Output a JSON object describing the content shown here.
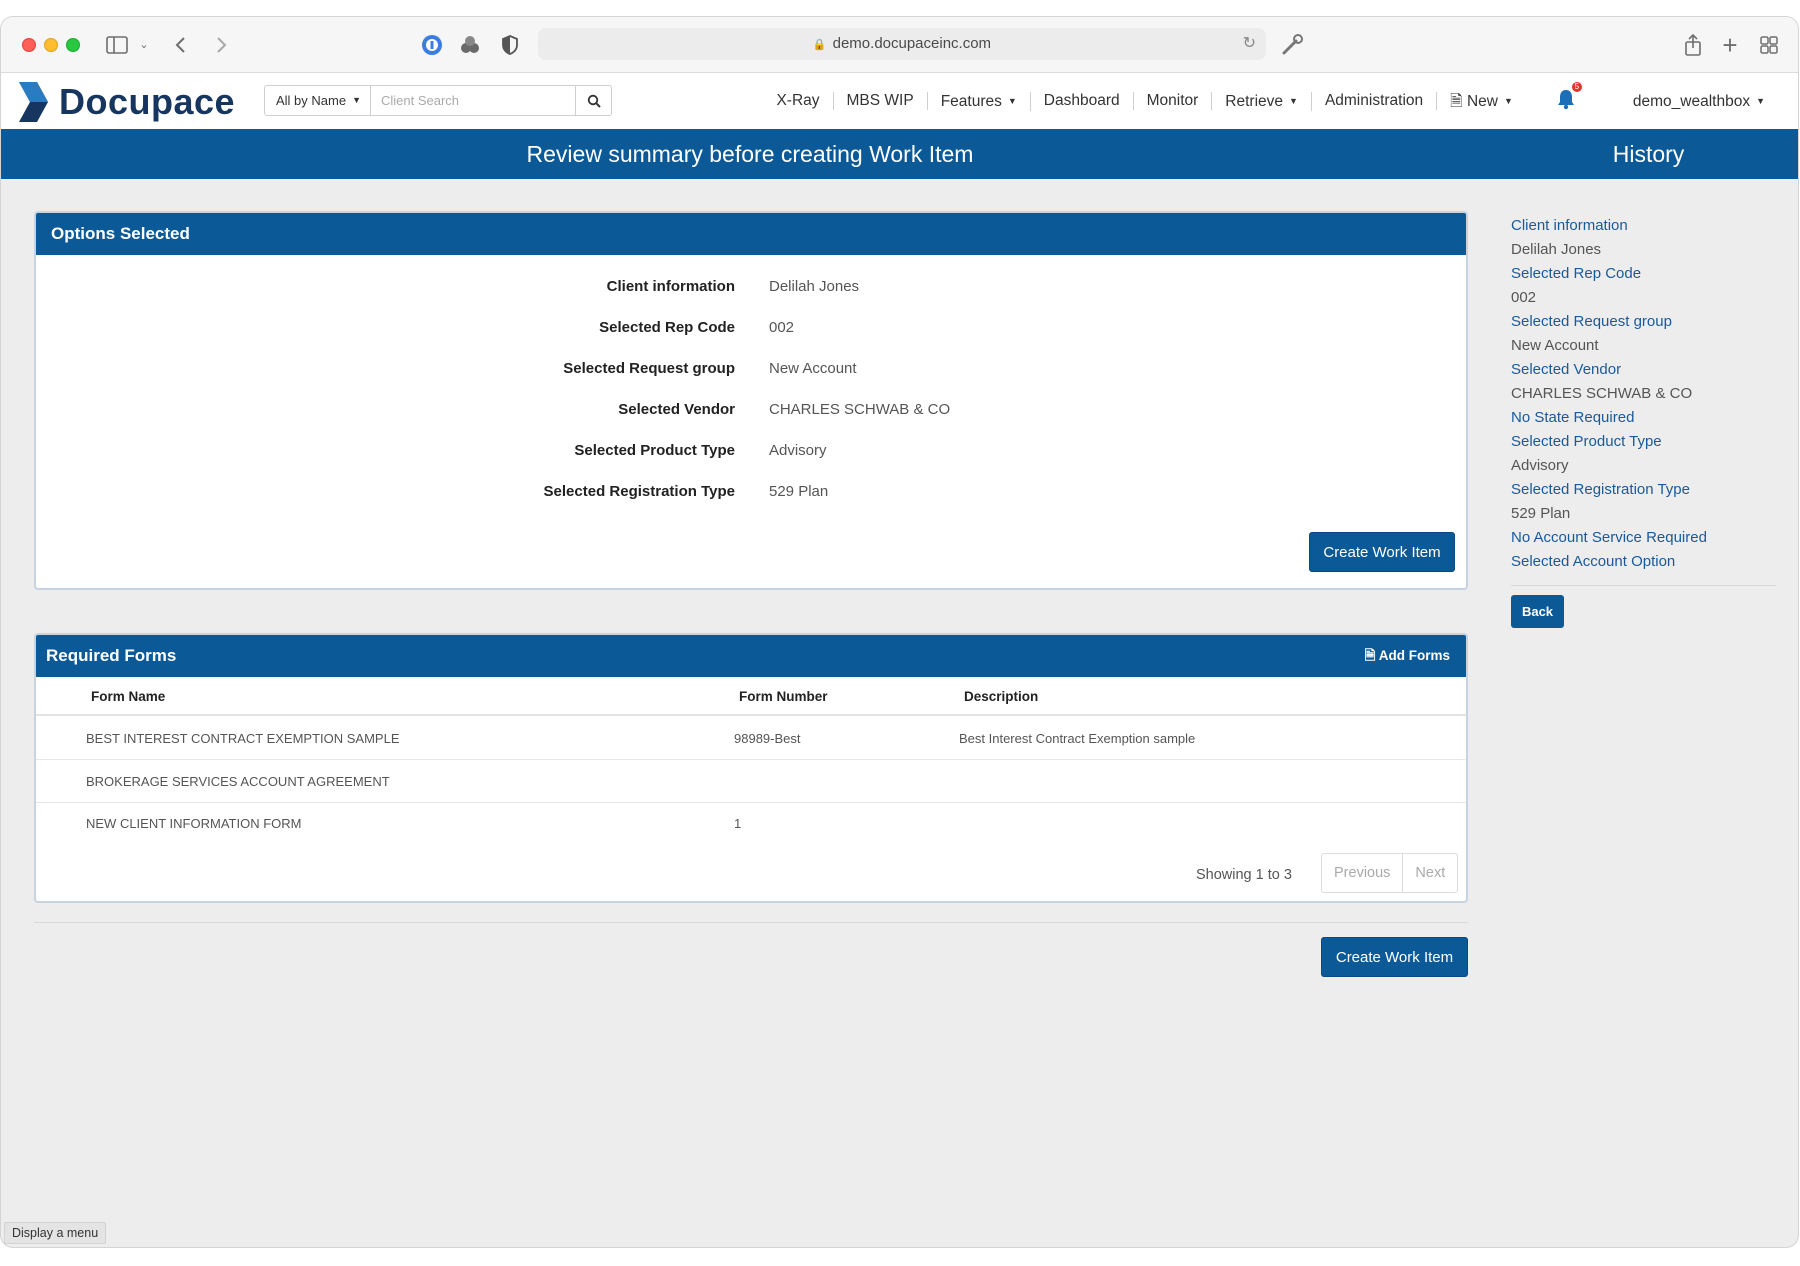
{
  "browser": {
    "url": "demo.docupaceinc.com"
  },
  "app": {
    "logo_text": "Docupace",
    "search_scope": "All by Name",
    "search_placeholder": "Client Search",
    "nav": {
      "xray": "X-Ray",
      "mbs_wip": "MBS WIP",
      "features": "Features",
      "dashboard": "Dashboard",
      "monitor": "Monitor",
      "retrieve": "Retrieve",
      "administration": "Administration",
      "new": "New",
      "user": "demo_wealthbox",
      "notification_count": "5"
    }
  },
  "page": {
    "title": "Review summary before creating Work Item",
    "history_title": "History"
  },
  "options": {
    "heading": "Options Selected",
    "rows": [
      {
        "label": "Client information",
        "value": "Delilah Jones"
      },
      {
        "label": "Selected Rep Code",
        "value": "002"
      },
      {
        "label": "Selected Request group",
        "value": "New Account"
      },
      {
        "label": "Selected Vendor",
        "value": "CHARLES SCHWAB & CO"
      },
      {
        "label": "Selected Product Type",
        "value": "Advisory"
      },
      {
        "label": "Selected Registration Type",
        "value": "529 Plan"
      }
    ],
    "create_button": "Create Work Item"
  },
  "forms": {
    "heading": "Required Forms",
    "add_forms": "Add Forms",
    "columns": {
      "name": "Form Name",
      "number": "Form Number",
      "description": "Description"
    },
    "rows": [
      {
        "name": "BEST INTEREST CONTRACT EXEMPTION SAMPLE",
        "number": "98989-Best",
        "description": "Best Interest Contract Exemption sample"
      },
      {
        "name": "BROKERAGE SERVICES ACCOUNT AGREEMENT",
        "number": "",
        "description": ""
      },
      {
        "name": "NEW CLIENT INFORMATION FORM",
        "number": "1",
        "description": ""
      }
    ],
    "showing": "Showing 1 to 3",
    "previous": "Previous",
    "next": "Next"
  },
  "bottom_create_button": "Create Work Item",
  "history": {
    "items": [
      {
        "link": "Client information",
        "value": "Delilah Jones"
      },
      {
        "link": "Selected Rep Code",
        "value": "002"
      },
      {
        "link": "Selected Request group",
        "value": "New Account"
      },
      {
        "link": "Selected Vendor",
        "value": "CHARLES SCHWAB & CO"
      },
      {
        "link": "No State Required",
        "value": ""
      },
      {
        "link": "Selected Product Type",
        "value": "Advisory"
      },
      {
        "link": "Selected Registration Type",
        "value": "529 Plan"
      },
      {
        "link": "No Account Service Required",
        "value": ""
      },
      {
        "link": "Selected Account Option",
        "value": ""
      }
    ],
    "back_button": "Back"
  },
  "status_tooltip": "Display a menu",
  "colors": {
    "brand_blue": "#0c5997",
    "link_blue": "#1a5a9a",
    "logo_navy": "#16355f"
  }
}
